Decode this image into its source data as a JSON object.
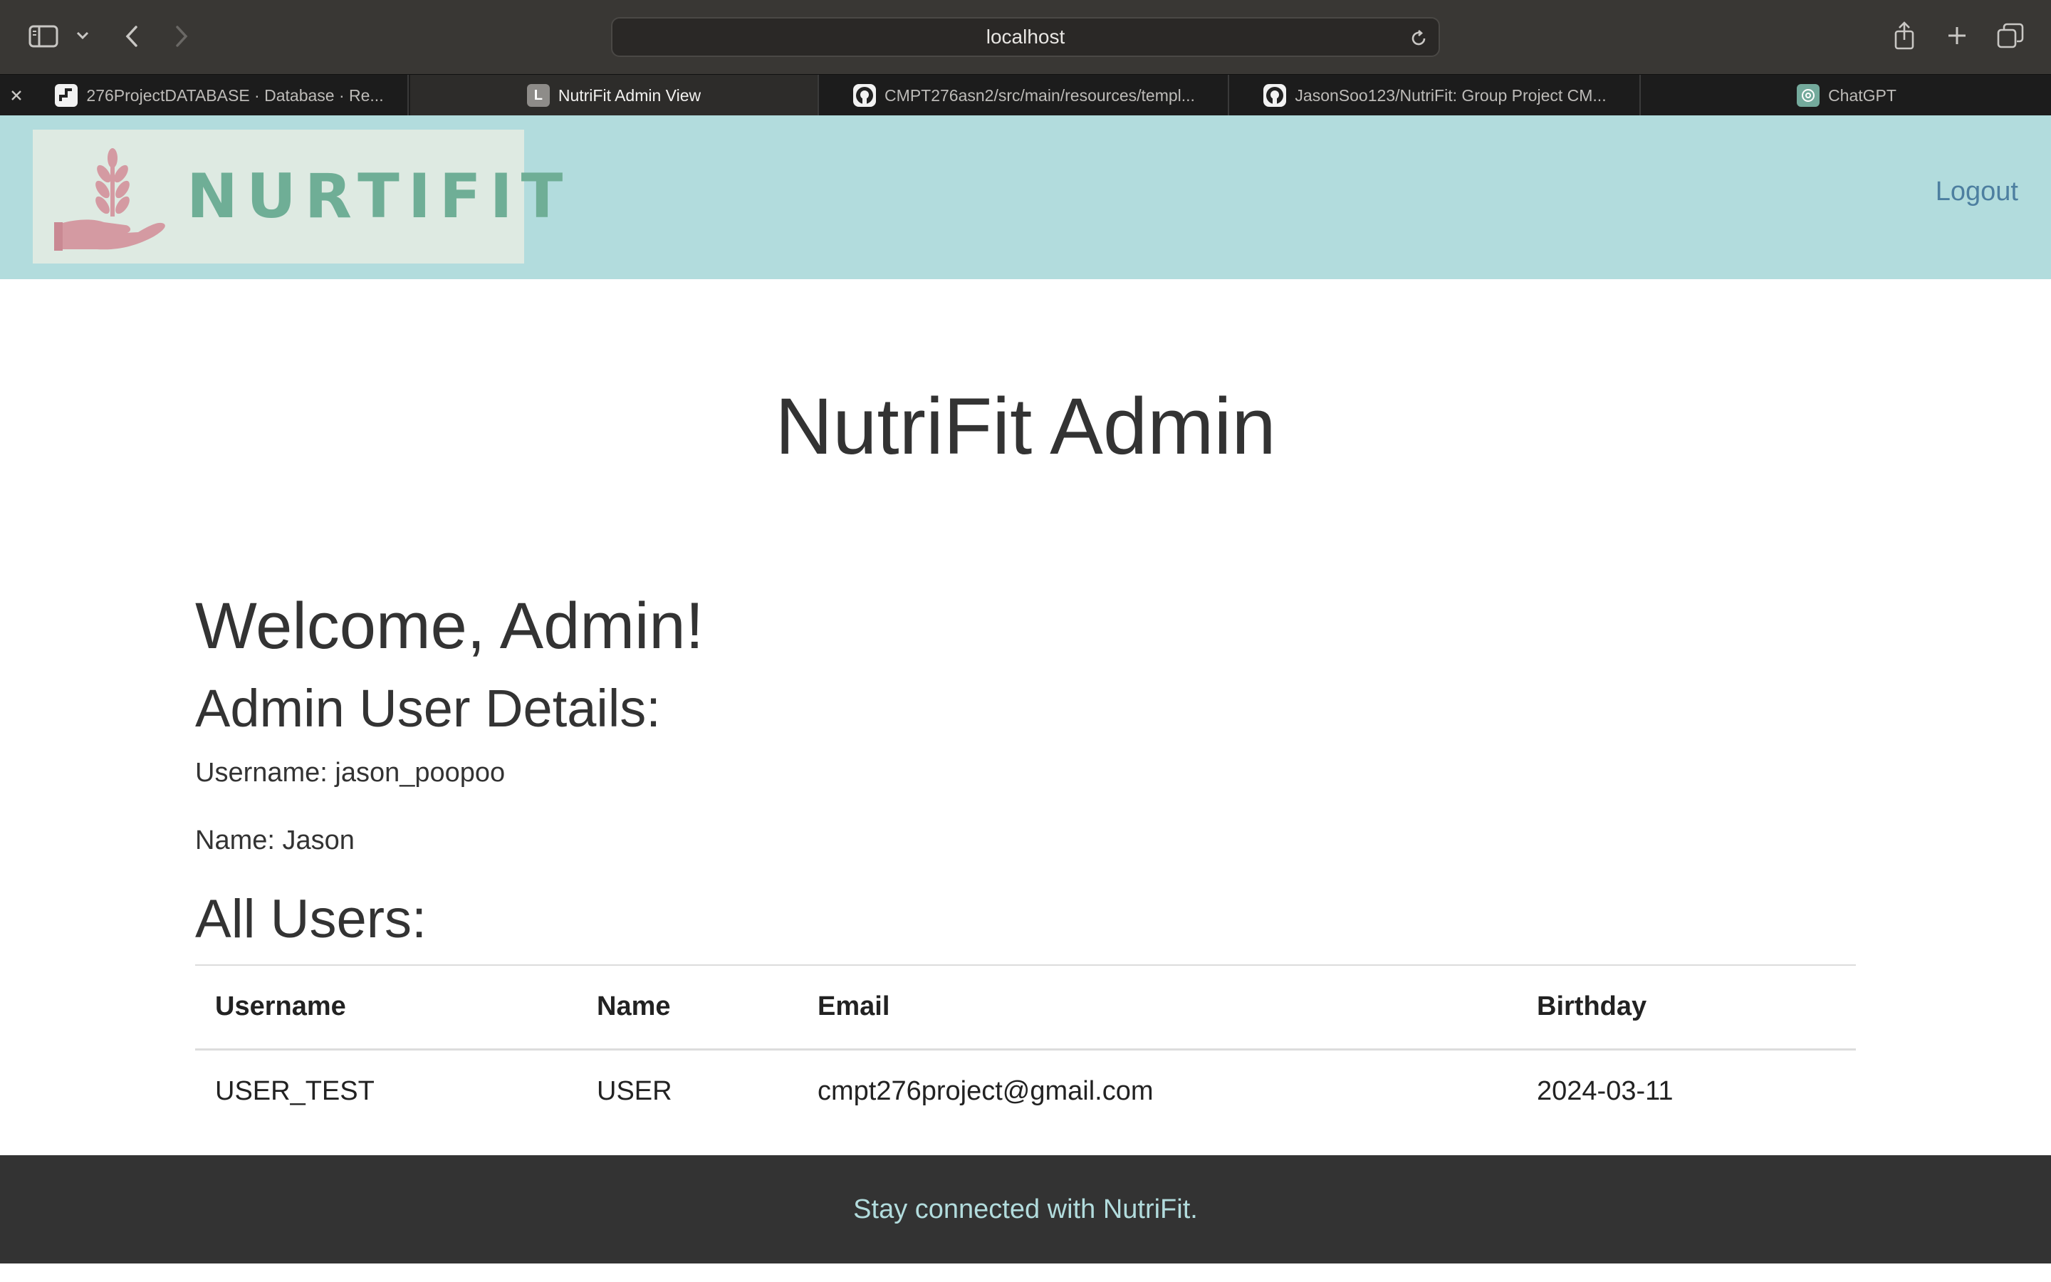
{
  "browser": {
    "url": "localhost",
    "icons": {
      "sidebar": "sidebar-icon",
      "back": "chevron-left-icon",
      "forward": "chevron-right-icon",
      "reload": "reload-icon",
      "share": "share-icon",
      "new_tab": "plus-icon",
      "tab_overview": "tab-overview-icon"
    },
    "tabs": [
      {
        "label": "276ProjectDATABASE · Database · Re...",
        "favicon": "database-icon",
        "active": false
      },
      {
        "label": "NutriFit Admin View",
        "favicon": "letter-l-icon",
        "favicon_text": "L",
        "active": true
      },
      {
        "label": "CMPT276asn2/src/main/resources/templ...",
        "favicon": "github-icon",
        "active": false
      },
      {
        "label": "JasonSoo123/NutriFit: Group Project CM...",
        "favicon": "github-icon",
        "active": false
      },
      {
        "label": "ChatGPT",
        "favicon": "chatgpt-icon",
        "active": false
      }
    ]
  },
  "header": {
    "logo_text": "NURTIFIT",
    "logout_label": "Logout"
  },
  "main": {
    "title": "NutriFit Admin",
    "welcome": "Welcome, Admin!",
    "details_heading": "Admin User Details:",
    "username_line": "Username: jason_poopoo",
    "name_line": "Name: Jason",
    "all_users_heading": "All Users:",
    "table": {
      "columns": [
        "Username",
        "Name",
        "Email",
        "Birthday"
      ],
      "rows": [
        [
          "USER_TEST",
          "USER",
          "cmpt276project@gmail.com",
          "2024-03-11"
        ]
      ]
    }
  },
  "footer": {
    "text": "Stay connected with NutriFit."
  },
  "colors": {
    "header_bg": "#b2dcdd",
    "logo_green": "#6fae96",
    "logo_pink": "#d49aa2",
    "footer_bg": "#333333",
    "footer_text": "#b2dcdd",
    "logout_link": "#4d7fa0"
  }
}
